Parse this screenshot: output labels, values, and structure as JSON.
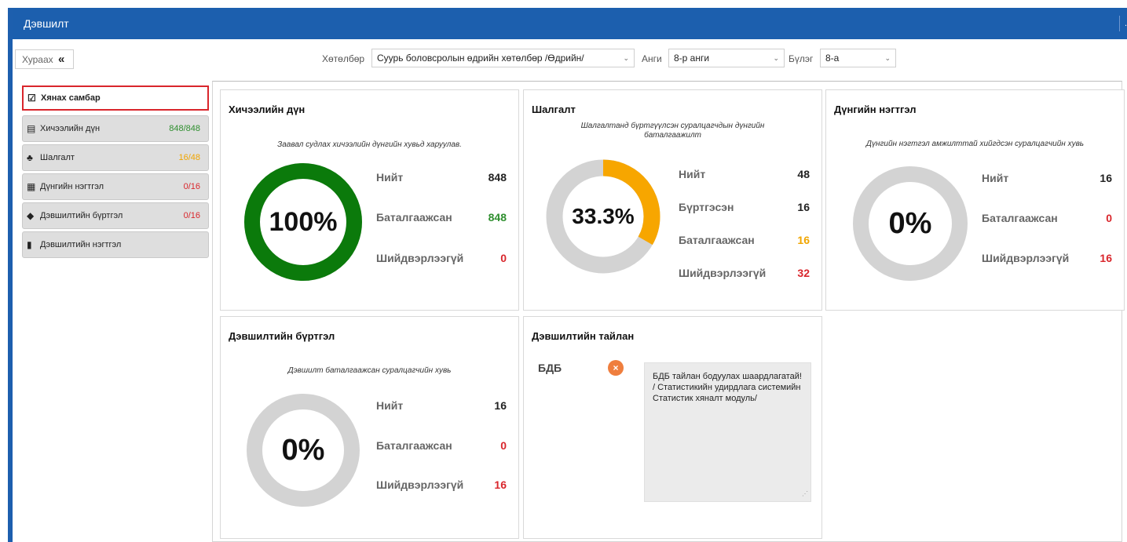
{
  "window": {
    "title": "Дэвшилт",
    "corner_mark": "."
  },
  "toolbar": {
    "collapse_label": "Хураах",
    "collapse_icon": "«"
  },
  "filters": {
    "program_label": "Хөтөлбөр",
    "program_value": "Суурь боловсролын өдрийн хөтөлбөр /Өдрийн/",
    "grade_label": "Анги",
    "grade_value": "8-р анги",
    "group_label": "Бүлэг",
    "group_value": "8-а"
  },
  "sidebar": {
    "items": [
      {
        "label": "Хянах самбар",
        "icon": "clipboard-icon",
        "glyph": "☑",
        "count": ""
      },
      {
        "label": "Хичээлийн дүн",
        "icon": "teacher-icon",
        "glyph": "▤",
        "count": "848/848",
        "count_color": "#2f8f2f"
      },
      {
        "label": "Шалгалт",
        "icon": "group-icon",
        "glyph": "♣",
        "count": "16/48",
        "count_color": "#f0a500"
      },
      {
        "label": "Дүнгийн нэгтгэл",
        "icon": "calculator-icon",
        "glyph": "▦",
        "count": "0/16",
        "count_color": "#d9262c"
      },
      {
        "label": "Дэвшилтийн бүртгэл",
        "icon": "graduation-cap-icon",
        "glyph": "◆",
        "count": "0/16",
        "count_color": "#d9262c"
      },
      {
        "label": "Дэвшилтийн нэгтгэл",
        "icon": "book-icon",
        "glyph": "▮",
        "count": ""
      }
    ]
  },
  "cards": {
    "grades": {
      "title": "Хичээлийн дүн",
      "subtitle": "Заавал судлах хичээлийн дүнгийн хувьд харуулав.",
      "percent_label": "100%",
      "fill_fraction": 1.0,
      "fill_color": "#0b7a0b",
      "rows": [
        {
          "label": "Нийт",
          "value": "848",
          "color": "#222222"
        },
        {
          "label": "Баталгаажсан",
          "value": "848",
          "color": "#2f8f2f"
        },
        {
          "label": "Шийдвэрлээгүй",
          "value": "0",
          "color": "#d9262c"
        }
      ]
    },
    "exam": {
      "title": "Шалгалт",
      "subtitle": "Шалгалтанд бүртгүүлсэн суралцагчдын дүнгийн баталгаажилт",
      "percent_label": "33.3%",
      "fill_fraction": 0.333,
      "fill_color": "#f7a600",
      "rows": [
        {
          "label": "Нийт",
          "value": "48",
          "color": "#222222"
        },
        {
          "label": "Бүртгэсэн",
          "value": "16",
          "color": "#222222"
        },
        {
          "label": "Баталгаажсан",
          "value": "16",
          "color": "#f0a500"
        },
        {
          "label": "Шийдвэрлээгүй",
          "value": "32",
          "color": "#d9262c"
        }
      ]
    },
    "summary": {
      "title": "Дүнгийн нэгтгэл",
      "subtitle": "Дүнгийн нэгтгэл амжилттай хийгдсэн суралцагчийн хувь",
      "percent_label": "0%",
      "fill_fraction": 0,
      "fill_color": "#0b7a0b",
      "rows": [
        {
          "label": "Нийт",
          "value": "16",
          "color": "#222222"
        },
        {
          "label": "Баталгаажсан",
          "value": "0",
          "color": "#d9262c"
        },
        {
          "label": "Шийдвэрлээгүй",
          "value": "16",
          "color": "#d9262c"
        }
      ]
    },
    "promotion": {
      "title": "Дэвшилтийн бүртгэл",
      "subtitle": "Дэвшилт баталгаажсан суралцагчийн хувь",
      "percent_label": "0%",
      "fill_fraction": 0,
      "fill_color": "#0b7a0b",
      "rows": [
        {
          "label": "Нийт",
          "value": "16",
          "color": "#222222"
        },
        {
          "label": "Баталгаажсан",
          "value": "0",
          "color": "#d9262c"
        },
        {
          "label": "Шийдвэрлээгүй",
          "value": "16",
          "color": "#d9262c"
        }
      ]
    },
    "report": {
      "title": "Дэвшилтийн тайлан",
      "item_label": "БДБ",
      "status_icon": "x-circle-icon",
      "note": "БДБ тайлан бодуулах шаардлагатай! / Статистикийн удирдлага системийн Статистик хяналт модуль/"
    }
  },
  "colors": {
    "header": "#1c5fae",
    "ring_base": "#d3d3d3",
    "active_border": "#d9262c"
  }
}
